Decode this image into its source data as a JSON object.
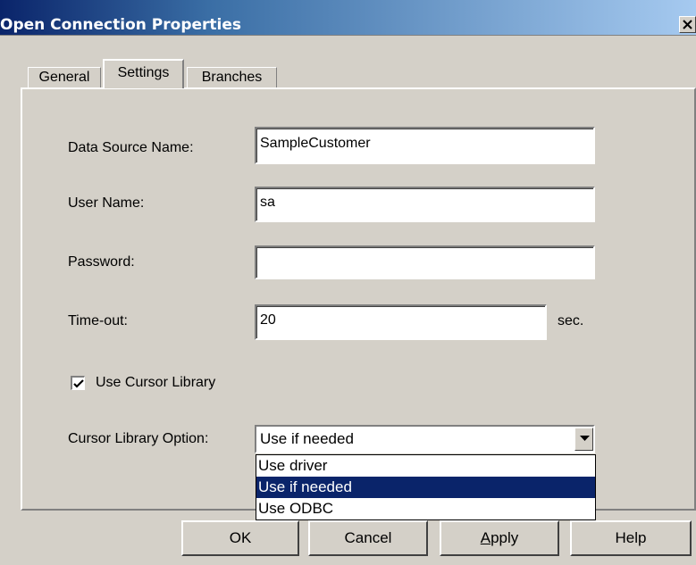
{
  "window": {
    "title": "Open Connection Properties",
    "close_label": "×"
  },
  "tabs": [
    {
      "label": "General",
      "active": false
    },
    {
      "label": "Settings",
      "active": true
    },
    {
      "label": "Branches",
      "active": false
    }
  ],
  "form": {
    "data_source_name": {
      "label": "Data Source Name:",
      "value": "SampleCustomer"
    },
    "user_name": {
      "label": "User Name:",
      "value": "sa"
    },
    "password": {
      "label": "Password:",
      "value": ""
    },
    "timeout": {
      "label": "Time-out:",
      "value": "20",
      "unit": "sec."
    },
    "use_cursor_library": {
      "label": "Use Cursor Library",
      "checked": true
    },
    "cursor_library_option": {
      "label": "Cursor Library Option:",
      "selected": "Use if needed",
      "options": [
        {
          "label": "Use driver",
          "selected": false
        },
        {
          "label": "Use if needed",
          "selected": true
        },
        {
          "label": "Use ODBC",
          "selected": false
        }
      ]
    }
  },
  "buttons": {
    "ok": "OK",
    "cancel": "Cancel",
    "apply_mnemonic": "A",
    "apply_rest": "pply",
    "help": "Help"
  },
  "icons": {
    "close": "close-icon",
    "check": "checkmark-icon",
    "dropdown": "chevron-down-icon"
  },
  "colors": {
    "title_start": "#0a246a",
    "title_end": "#a6caf0",
    "dialog_bg": "#d4d0c8",
    "selection_bg": "#0a246a",
    "selection_text": "#ffffff"
  }
}
